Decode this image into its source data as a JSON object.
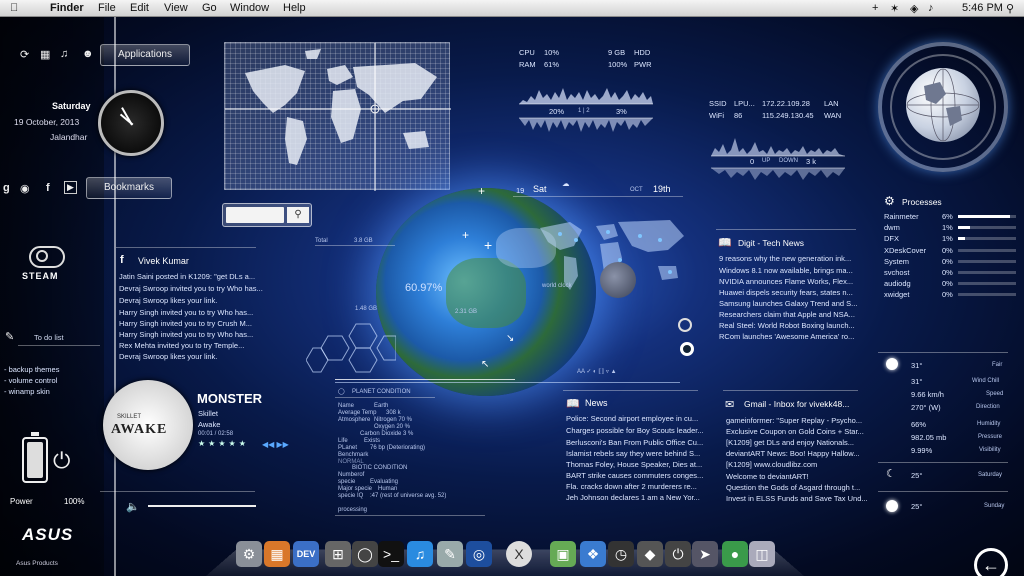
{
  "menubar": {
    "app": "Finder",
    "items": [
      "File",
      "Edit",
      "View",
      "Go",
      "Window",
      "Help"
    ],
    "time": "5:46 PM"
  },
  "sidebar": {
    "applications_label": "Applications",
    "day": "Saturday",
    "date": "19 October, 2013",
    "city": "Jalandhar",
    "bookmarks_label": "Bookmarks",
    "steam_label": "STEAM",
    "todo_label": "To do list",
    "todo_items": [
      "- backup themes",
      "- volume control",
      "- winamp skin"
    ],
    "power_label": "Power",
    "power_value": "100%",
    "brand": "ASUS",
    "brand_sub": "Asus Products"
  },
  "system": {
    "cpu_label": "CPU",
    "cpu_value": "10%",
    "ram_label": "RAM",
    "ram_value": "61%",
    "hdd_value": "9 GB",
    "hdd_label": "HDD",
    "pwr_value": "100%",
    "pwr_label": "PWR",
    "load_left": "20%",
    "load_mid": "1 | 2",
    "load_right": "3%"
  },
  "network": {
    "ssid_label": "SSID",
    "ssid_value": "LPU...",
    "ip_lan": "172.22.109.28",
    "lan_label": "LAN",
    "wifi_label": "WiFi",
    "wifi_value": "86",
    "ip_wan": "115.249.130.45",
    "wan_label": "WAN",
    "up_value": "0",
    "up_label": "UP",
    "down_label": "DOWN",
    "down_value": "3 k"
  },
  "search": {
    "placeholder": ""
  },
  "facebook": {
    "title": "Vivek Kumar",
    "items": [
      "Jatin Saini posted in K1209: \"get DLs a...",
      "Devraj Swroop invited you to try Who has...",
      "Devraj Swroop likes your link.",
      "Harry Singh invited you to try Who has...",
      "Harry Singh invited you to try Crush M...",
      "Harry Singh invited you to try Who has...",
      "Rex Mehta invited you to try Temple...",
      "Devraj Swroop likes your link."
    ]
  },
  "earth": {
    "day_num": "19",
    "day": "Sat",
    "month": "OCT",
    "date": "19th",
    "total_label": "Total",
    "total_value": "3.8 GB",
    "used": "1.48 GB",
    "percent": "60.97%",
    "free": "2.31 GB",
    "world_clock": "world clock"
  },
  "music": {
    "artist_title": "MONSTER",
    "band": "Skillet",
    "album": "Awake",
    "time": "00:01 / 02:58",
    "album_art_text": "AWAKE",
    "album_art_brand": "SKILLET"
  },
  "planet": {
    "title": "PLANET CONDITION",
    "rows": [
      [
        "Name",
        "Earth"
      ],
      [
        "Average Temp",
        "308 k"
      ],
      [
        "Atmosphere",
        "Nitrogen 70 %"
      ],
      [
        "",
        "Oxygen 20 %"
      ],
      [
        "",
        "Carbon Dioxide 3 %"
      ],
      [
        "Life",
        "Exists"
      ],
      [
        "PLanet",
        "76 bp (Deteriorating)"
      ],
      [
        "Benchmark",
        ""
      ],
      [
        "NORMAL",
        ""
      ]
    ],
    "biotic_title": "BIOTIC CONDITION",
    "biotic_rows": [
      [
        "Numberof",
        ""
      ],
      [
        "specie",
        "Evaluating"
      ],
      [
        "Major specie",
        "Human"
      ],
      [
        "specie IQ",
        ":47 (rest of universe avg. 52)"
      ]
    ],
    "processing": "processing"
  },
  "news": {
    "title": "News",
    "items": [
      "Police: Second airport employee in cu...",
      "Charges possible for Boy Scouts leader...",
      "Berlusconi's Ban From Public Office Cu...",
      "Islamist rebels say they were behind S...",
      "Thomas Foley, House Speaker, Dies at...",
      "BART strike causes commuters conges...",
      "Fla. cracks down after 2 murderers re...",
      "Jeh Johnson declares 1 am a New Yor..."
    ]
  },
  "technews": {
    "title": "Digit - Tech News",
    "items": [
      "9 reasons why the new generation ink...",
      "Windows 8.1 now available, brings ma...",
      "NVIDIA announces Flame Works, Flex...",
      "Huawei dispels security fears, states n...",
      "Samsung launches Galaxy Trend and S...",
      "Researchers claim that Apple and NSA...",
      "Real Steel: World Robot Boxing launch...",
      "RCom launches 'Awesome America' ro..."
    ]
  },
  "gmail": {
    "title": "Gmail - Inbox for vivekk48...",
    "items": [
      "gameinformer: \"Super Replay - Psycho...",
      "Exclusive Coupon on Gold Coins + Star...",
      "[K1209] get DLs and enjoy Nationals...",
      "deviantART News: Boo! Happy Hallow...",
      "[K1209] www.cloudlibz.com",
      "Welcome to deviantART!",
      "Question the Gods of Asgard through t...",
      "Invest in ELSS Funds and Save Tax Und..."
    ]
  },
  "processes": {
    "title": "Processes",
    "items": [
      {
        "name": "Rainmeter",
        "value": "6%",
        "level": 0.9
      },
      {
        "name": "dwm",
        "value": "1%",
        "level": 0.2
      },
      {
        "name": "DFX",
        "value": "1%",
        "level": 0.12
      },
      {
        "name": "XDeskCover",
        "value": "0%",
        "level": 0
      },
      {
        "name": "System",
        "value": "0%",
        "level": 0
      },
      {
        "name": "svchost",
        "value": "0%",
        "level": 0
      },
      {
        "name": "audiodg",
        "value": "0%",
        "level": 0
      },
      {
        "name": "xwidget",
        "value": "0%",
        "level": 0
      }
    ]
  },
  "weather": {
    "temp": "31°",
    "cond": "Fair",
    "feels": "31°",
    "feels_label": "Wind Chill",
    "wind": "9.66 km/h",
    "wind_label": "Speed",
    "dir": "270° (W)",
    "dir_label": "Direction",
    "humidity": "66%",
    "humidity_label": "Humidity",
    "pressure": "982.05 mb",
    "pressure_label": "Pressure",
    "visibility": "9.99%",
    "visibility_label": "Visibility",
    "sat_temp": "25°",
    "sat_label": "Saturday",
    "sun_temp": "25°",
    "sun_label": "Sunday"
  },
  "dock": {
    "items": [
      "settings",
      "apps",
      "dev",
      "calculator",
      "photo",
      "terminal",
      "itunes",
      "preview",
      "globe",
      "osx",
      "photos",
      "safari",
      "clock",
      "fox",
      "power",
      "launchpad",
      "evernote",
      "trash"
    ]
  },
  "colors": {
    "accent": "#5aa9ff"
  }
}
